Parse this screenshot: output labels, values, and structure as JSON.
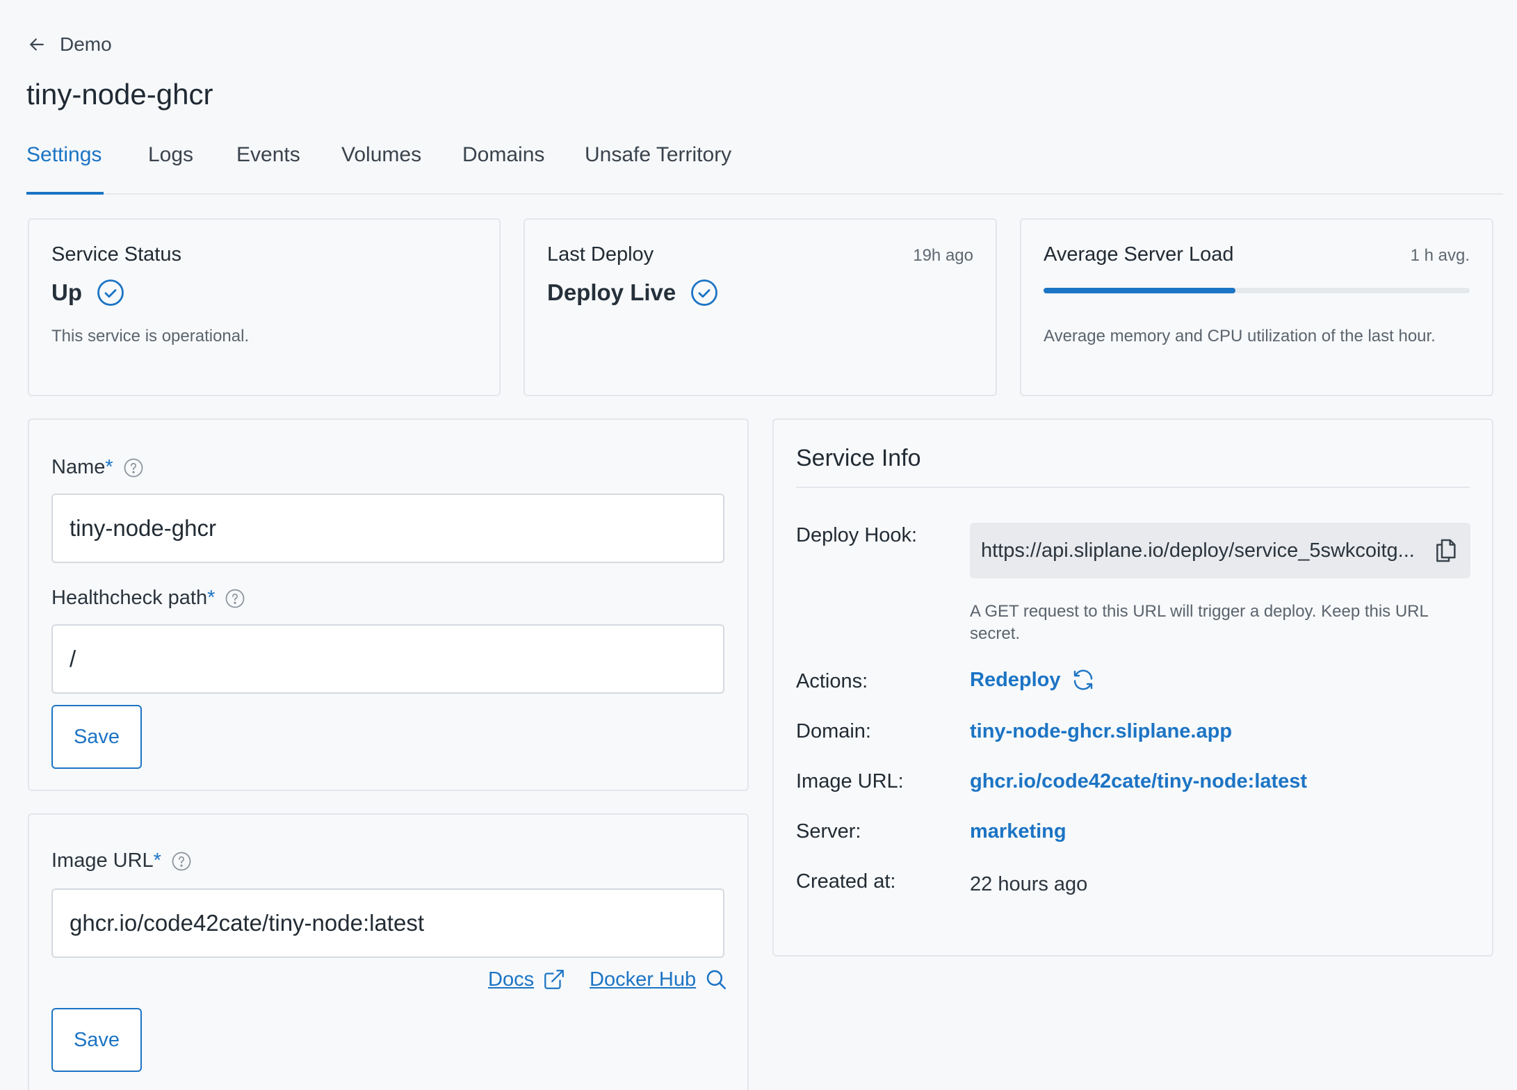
{
  "header": {
    "back_label": "Demo",
    "title": "tiny-node-ghcr"
  },
  "tabs": [
    {
      "label": "Settings",
      "active": true
    },
    {
      "label": "Logs"
    },
    {
      "label": "Events"
    },
    {
      "label": "Volumes"
    },
    {
      "label": "Domains"
    },
    {
      "label": "Unsafe Territory"
    }
  ],
  "status_cards": {
    "service_status": {
      "label": "Service Status",
      "value": "Up",
      "description": "This service is operational."
    },
    "last_deploy": {
      "label": "Last Deploy",
      "meta": "19h ago",
      "value": "Deploy Live"
    },
    "server_load": {
      "label": "Average Server Load",
      "meta": "1 h avg.",
      "load_fraction": 0.45,
      "description": "Average memory and CPU utilization of the last hour."
    }
  },
  "settings_form": {
    "name_label": "Name",
    "name_value": "tiny-node-ghcr",
    "healthcheck_label": "Healthcheck path",
    "healthcheck_value": "/",
    "required_mark": "*",
    "save_label": "Save"
  },
  "image_form": {
    "image_label": "Image URL",
    "image_value": "ghcr.io/code42cate/tiny-node:latest",
    "required_mark": "*",
    "docs_label": "Docs",
    "dockerhub_label": "Docker Hub",
    "save_label": "Save"
  },
  "service_info": {
    "title": "Service Info",
    "deploy_hook_label": "Deploy Hook:",
    "deploy_hook_value": "https://api.sliplane.io/deploy/service_5swkcoitg...",
    "deploy_hook_note": "A GET request to this URL will trigger a deploy. Keep this URL secret.",
    "actions_label": "Actions:",
    "redeploy_label": "Redeploy",
    "domain_label": "Domain:",
    "domain_value": "tiny-node-ghcr.sliplane.app",
    "image_url_label": "Image URL:",
    "image_url_value": "ghcr.io/code42cate/tiny-node:latest",
    "server_label": "Server:",
    "server_value": "marketing",
    "created_label": "Created at:",
    "created_value": "22 hours ago"
  },
  "colors": {
    "accent": "#1c74c4",
    "background": "#f6f8fa"
  },
  "icons": [
    "arrow-left-icon",
    "check-circle-icon",
    "help-circle-icon",
    "copy-icon",
    "refresh-icon",
    "external-link-icon",
    "search-icon"
  ]
}
